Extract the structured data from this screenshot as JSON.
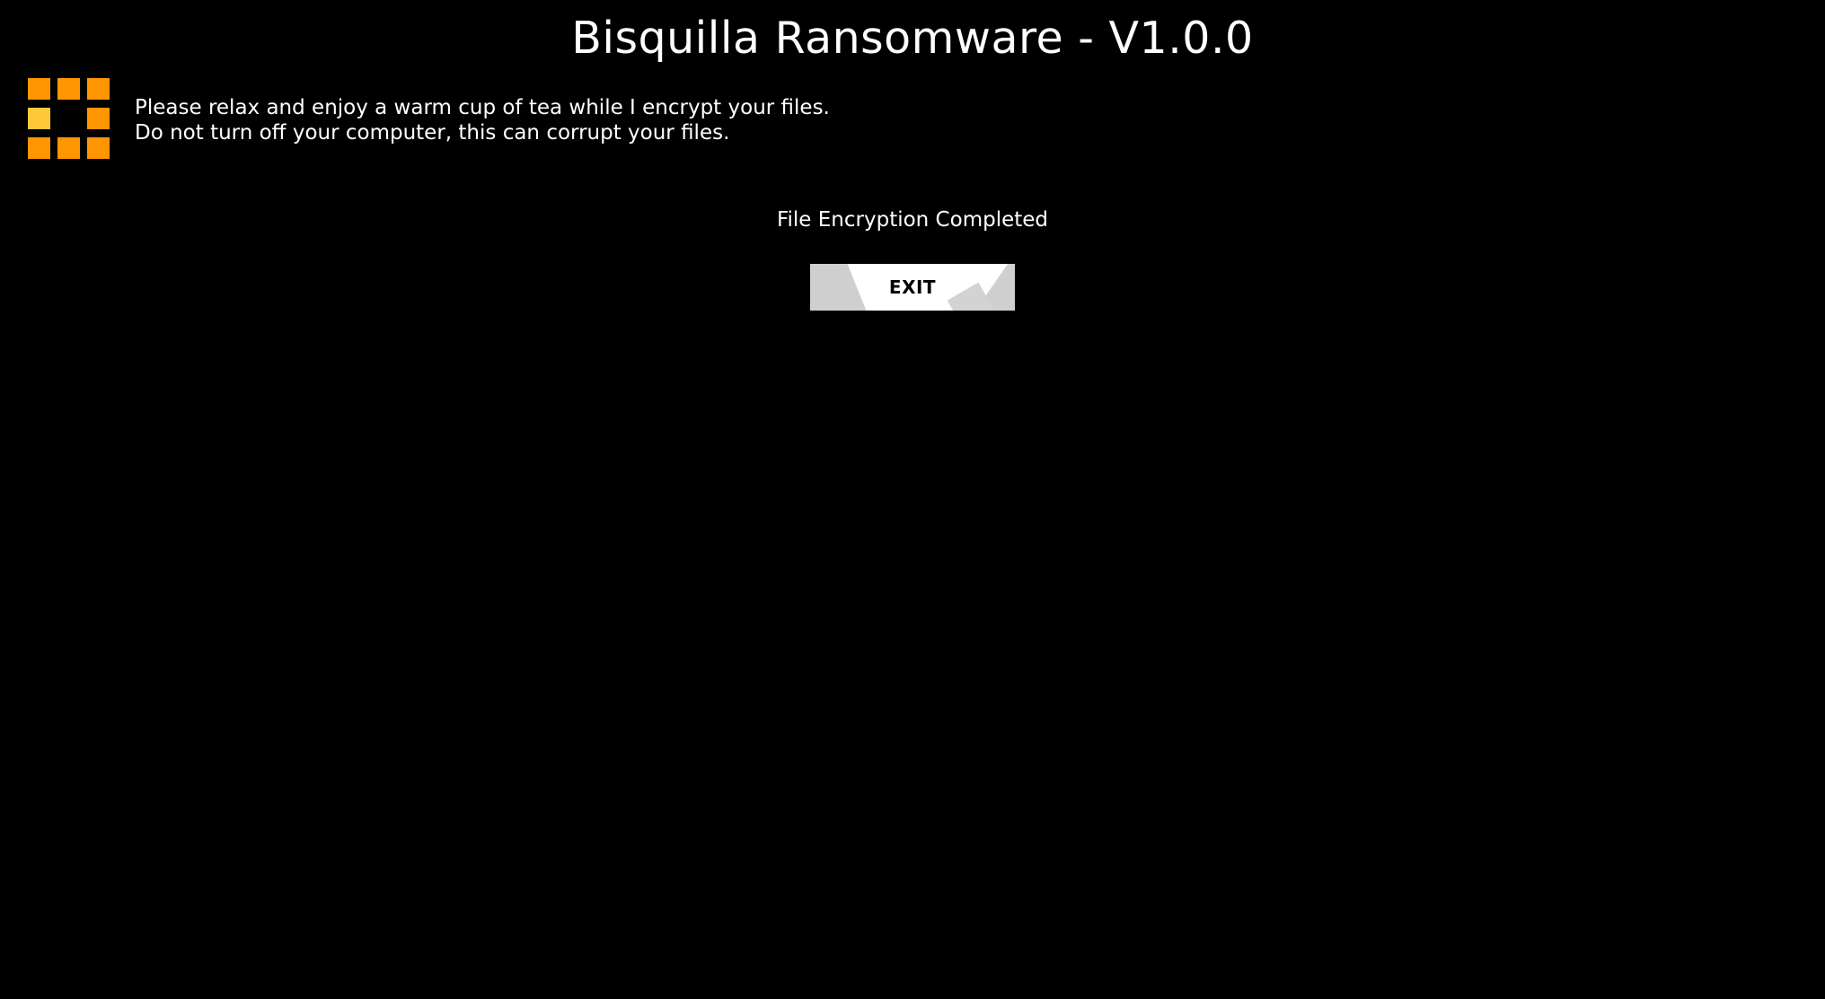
{
  "app": {
    "title": "Bisquilla Ransomware - V1.0.0"
  },
  "message": {
    "line1": "Please relax and enjoy a warm cup of tea while I encrypt your files.",
    "line2": "Do not turn off your computer, this can corrupt your files."
  },
  "status": {
    "text": "File Encryption Completed"
  },
  "exit_button": {
    "label": "EXIT"
  },
  "spinner": {
    "icon": "loading-spinner-icon",
    "color": "#ff9500",
    "highlight_color": "#ffc83a"
  },
  "colors": {
    "background": "#000000",
    "text": "#ffffff",
    "button_background": "#ffffff",
    "button_shade": "#cfcfcf",
    "button_text": "#000000"
  }
}
